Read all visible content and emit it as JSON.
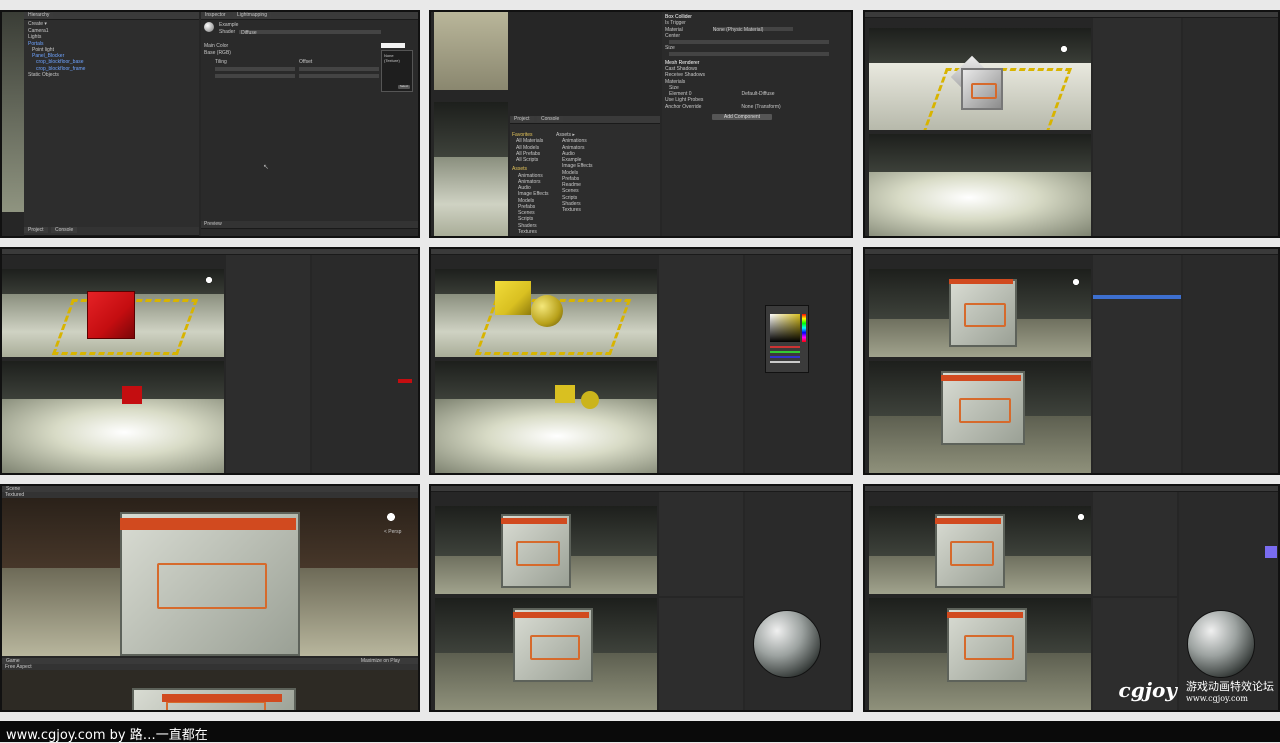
{
  "tile1": {
    "hierarchy_tab": "Hierarchy",
    "create_label": "Create ▾",
    "tree": [
      "Camera1",
      "Lights",
      "Portals",
      "Point light",
      "Panel_Blocker",
      "crop_blockfloor_base",
      "crop_blockfloor_frame",
      "Static Objects"
    ],
    "inspector_tab": "Inspector",
    "lightmapping_tab": "Lightmapping",
    "material_name": "Example",
    "shader_label": "Shader",
    "shader_value": "Diffuse",
    "main_color": "Main Color",
    "base_rgb": "Base (RGB)",
    "tiling": "Tiling",
    "offset": "Offset",
    "none_texture": "None (Texture)",
    "select": "Select",
    "project_tab": "Project",
    "console_tab": "Console",
    "preview": "Preview"
  },
  "tile2": {
    "box_collider": "Box Collider",
    "trigger": "Is Trigger",
    "material": "Material",
    "material_value": "None (Physic Material)",
    "center": "Center",
    "size": "Size",
    "mesh_renderer": "Mesh Renderer",
    "cast_shadows": "Cast Shadows",
    "receive_shadows": "Receive Shadows",
    "materials": "Materials",
    "size2": "Size",
    "element0": "Element 0",
    "default_diffuse": "Default-Diffuse",
    "use_light_probes": "Use Light Probes",
    "anchor_override": "Anchor Override",
    "none_transform": "None (Transform)",
    "add_component": "Add Component",
    "project_tab": "Project",
    "console_tab": "Console",
    "favorites": "Favorites",
    "fav_items": [
      "All Materials",
      "All Models",
      "All Prefabs",
      "All Scripts"
    ],
    "assets": "Assets",
    "asset_items": [
      "Animations",
      "Animators",
      "Audio",
      "Image Effects",
      "Models",
      "Prefabs",
      "Scenes",
      "Scripts",
      "Shaders",
      "Textures"
    ],
    "assets_header": "Assets ▸",
    "asset_grid": [
      "Animations",
      "Animators",
      "Audio",
      "Example",
      "Image Effects",
      "Models",
      "Prefabs",
      "Readme",
      "Scenes",
      "Scripts",
      "Shaders",
      "Textures"
    ]
  },
  "tile7": {
    "scene_tab": "Scene",
    "textured": "Textured",
    "persp": "< Persp",
    "game_tab": "Game",
    "free_aspect": "Free Aspect",
    "maximize": "Maximize on Play"
  },
  "footer": {
    "text": "www.cgjoy.com by 路…一直都在"
  },
  "watermark": {
    "logo": "cgjoy",
    "cn": "游戏动画特效论坛",
    "url": "www.cgjoy.com"
  },
  "colors": {
    "red_cube": "#c40d10",
    "yellow_cube": "#d9c021",
    "select_blue": "#3d6fcf"
  }
}
